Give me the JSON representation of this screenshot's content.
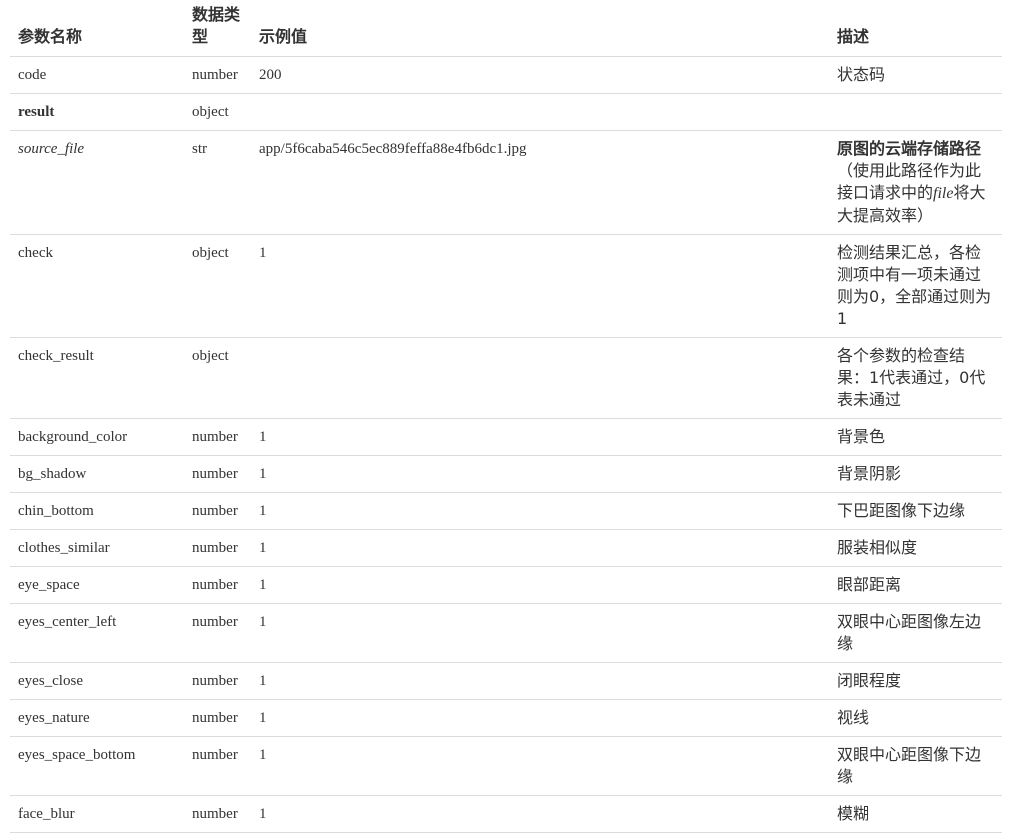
{
  "header": {
    "name": "参数名称",
    "type": "数据类型",
    "example": "示例值",
    "description": "描述"
  },
  "rows": [
    {
      "name": "code",
      "type": "number",
      "example": "200",
      "description": "状态码"
    },
    {
      "name": "result",
      "type": "object",
      "example": "",
      "description": ""
    },
    {
      "name": "source_file",
      "type": "str",
      "example": "app/5f6caba546c5ec889feffa88e4fb6dc1.jpg",
      "description_strong": "原图的云端存储路径",
      "description_pre": "（使用此路径作为此接口请求中的",
      "description_em": "file",
      "description_post": "将大大提高效率）"
    },
    {
      "name": "check",
      "type": "object",
      "example": "1",
      "description": "检测结果汇总，各检测项中有一项未通过则为0，全部通过则为1"
    },
    {
      "name": "check_result",
      "type": "object",
      "example": "",
      "description": "各个参数的检查结果：1代表通过，0代表未通过"
    },
    {
      "name": "background_color",
      "type": "number",
      "example": "1",
      "description": "背景色"
    },
    {
      "name": "bg_shadow",
      "type": "number",
      "example": "1",
      "description": "背景阴影"
    },
    {
      "name": "chin_bottom",
      "type": "number",
      "example": "1",
      "description": "下巴距图像下边缘"
    },
    {
      "name": "clothes_similar",
      "type": "number",
      "example": "1",
      "description": "服装相似度"
    },
    {
      "name": "eye_space",
      "type": "number",
      "example": "1",
      "description": "眼部距离"
    },
    {
      "name": "eyes_center_left",
      "type": "number",
      "example": "1",
      "description": "双眼中心距图像左边缘"
    },
    {
      "name": "eyes_close",
      "type": "number",
      "example": "1",
      "description": "闭眼程度"
    },
    {
      "name": "eyes_nature",
      "type": "number",
      "example": "1",
      "description": "视线"
    },
    {
      "name": "eyes_space_bottom",
      "type": "number",
      "example": "1",
      "description": "双眼中心距图像下边缘"
    },
    {
      "name": "face_blur",
      "type": "number",
      "example": "1",
      "description": "模糊"
    }
  ]
}
